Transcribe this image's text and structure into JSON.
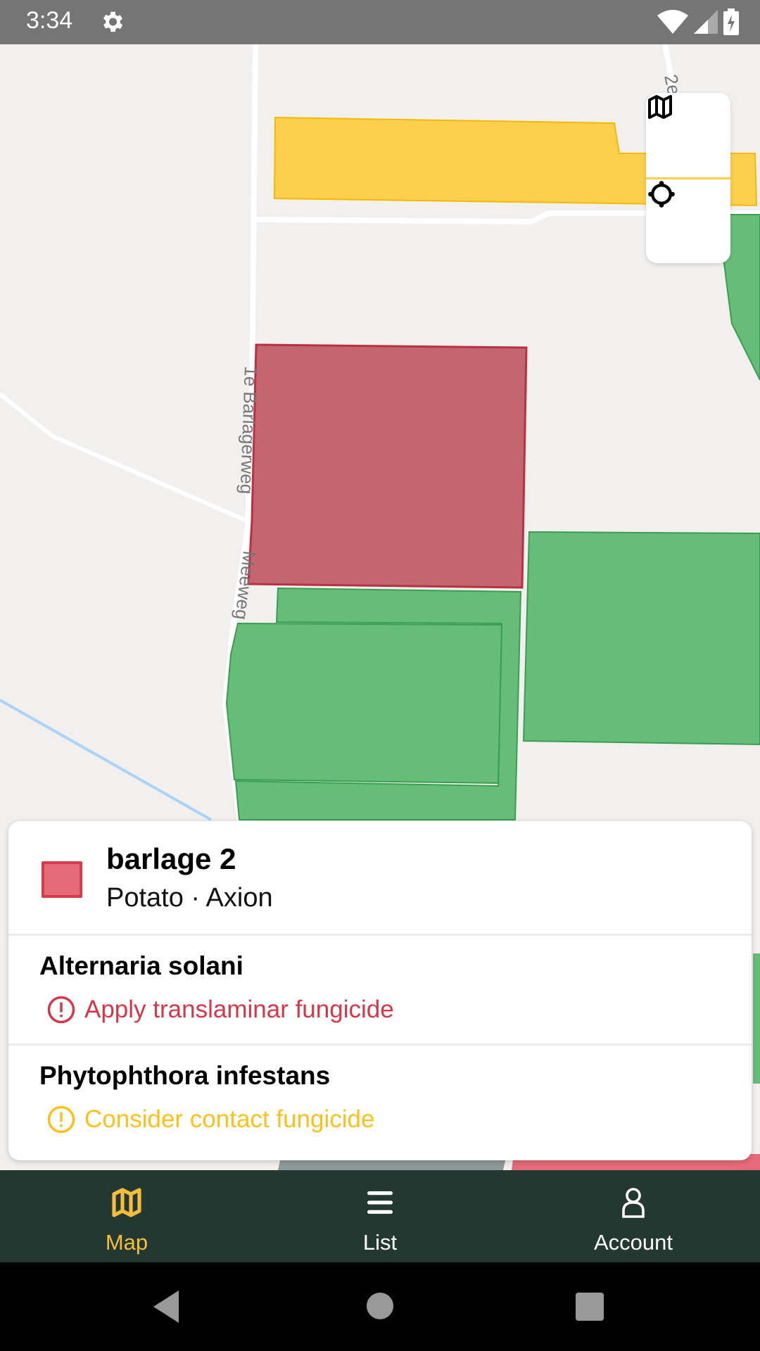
{
  "status_bar": {
    "time": "3:34",
    "icons": [
      "settings-icon",
      "wifi-icon",
      "signal-icon",
      "battery-charging-icon"
    ]
  },
  "map": {
    "road_labels": [
      "1e Barlagerweg",
      "Meeweg",
      "2e"
    ],
    "controls": [
      {
        "name": "map-layers",
        "icon": "map-icon"
      },
      {
        "name": "my-location",
        "icon": "crosshair-icon"
      }
    ],
    "field_colors": {
      "selected": "#c46570",
      "warning": "#fcd04d",
      "ok": "#66bd78"
    }
  },
  "field_card": {
    "name": "barlage 2",
    "subtitle": "Potato · Axion",
    "swatch_color": "#e56b7a",
    "diseases": [
      {
        "name": "Alternaria solani",
        "advice": "Apply translaminar fungicide",
        "severity": "high",
        "color": "#d5374a",
        "icon": "alert-circle-icon"
      },
      {
        "name": "Phytophthora infestans",
        "advice": "Consider contact fungicide",
        "severity": "medium",
        "color": "#f9c11a",
        "icon": "alert-circle-icon"
      }
    ]
  },
  "bottom_nav": {
    "active": "Map",
    "items": [
      {
        "label": "Map",
        "icon": "map-icon"
      },
      {
        "label": "List",
        "icon": "list-icon"
      },
      {
        "label": "Account",
        "icon": "person-icon"
      }
    ],
    "active_color": "#f4be3c",
    "inactive_color": "#ffffff"
  },
  "system_nav": {
    "buttons": [
      "back",
      "home",
      "recents"
    ]
  }
}
